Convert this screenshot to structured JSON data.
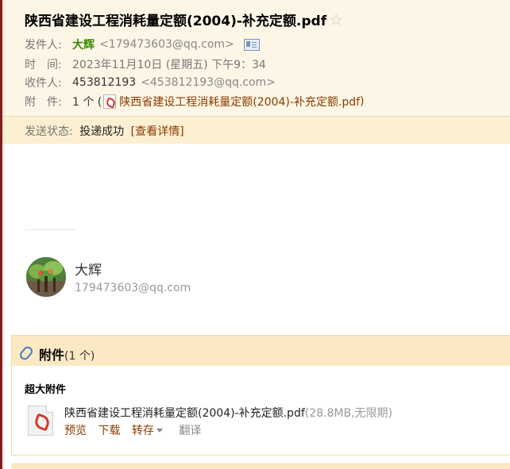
{
  "header": {
    "subject": "陕西省建设工程消耗量定额(2004)-补充定额.pdf",
    "sender_label": "发件人:",
    "sender_name": "大辉",
    "sender_addr": "<179473603@qq.com>",
    "time_label": "时　间:",
    "time_value": "2023年11月10日 (星期五) 下午9：34",
    "recipient_label": "收件人:",
    "recipient_name": "453812193",
    "recipient_addr": "<453812193@qq.com>",
    "attach_label": "附　件:",
    "attach_count": "1 个 (",
    "attach_name": "陕西省建设工程消耗量定额(2004)-补充定额.pdf",
    "attach_close": ")",
    "status_label": "发送状态:",
    "status_value": "投递成功",
    "status_detail": "[查看详情]"
  },
  "body": {
    "signature_name": "大辉",
    "signature_email": "179473603@qq.com"
  },
  "attachments": {
    "title": "附件",
    "count": "(1 个)",
    "large_label": "超大附件",
    "files": [
      {
        "name": "陕西省建设工程消耗量定额(2004)-补充定额.pdf",
        "meta": "(28.8MB,无限期)",
        "actions": {
          "preview": "预览",
          "download": "下载",
          "save": "转存",
          "translate": "翻译"
        }
      }
    ]
  },
  "colors": {
    "accent_border": "#8b1a1a",
    "header_bg": "#fdf6e6",
    "status_bg": "#fcefd2",
    "section_bg": "#fbe9c4",
    "sender_green": "#3a8a00",
    "link_brown": "#8a3a00"
  },
  "icons": {
    "star": "star-icon",
    "contact_card": "contact-card-icon",
    "pdf": "pdf-file-icon",
    "paperclip": "paperclip-icon",
    "dropdown": "chevron-down-icon"
  }
}
